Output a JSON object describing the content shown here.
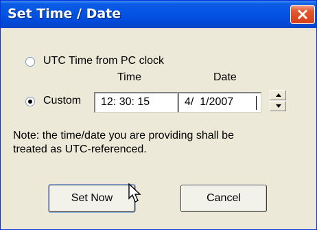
{
  "window": {
    "title": "Set Time / Date"
  },
  "options": {
    "utc_label": "UTC Time from PC clock",
    "custom_label": "Custom",
    "selected": "custom"
  },
  "fields": {
    "time_header": "Time",
    "date_header": "Date",
    "time_value": "12: 30: 15",
    "date_value": "4/  1/2007"
  },
  "note": {
    "line1": "Note: the time/date you are providing shall be",
    "line2": "treated as UTC-referenced."
  },
  "buttons": {
    "set_now": "Set Now",
    "cancel": "Cancel"
  },
  "colors": {
    "titlebar": "#0554e3",
    "close": "#d4401a",
    "dialog_bg": "#ece9d8"
  },
  "icons": {
    "close": "close-icon",
    "spin_up": "chevron-up-icon",
    "spin_down": "chevron-down-icon",
    "cursor": "mouse-pointer-icon"
  }
}
